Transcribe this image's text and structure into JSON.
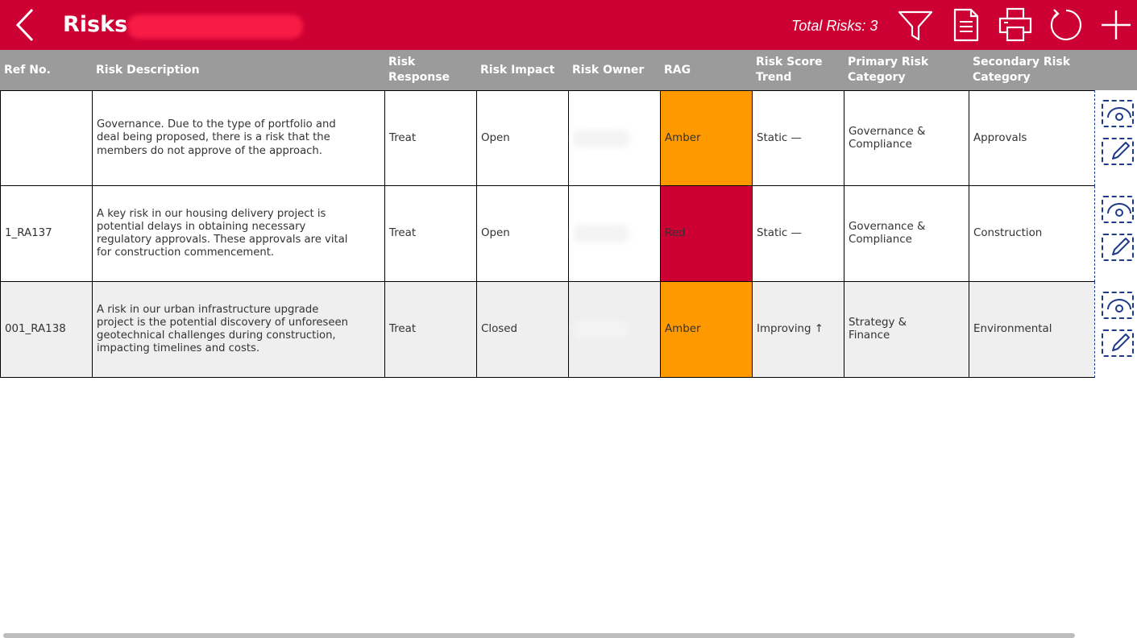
{
  "header": {
    "title": "Risks",
    "total_risks": "Total Risks: 3",
    "colors": {
      "brand": "#cc0033",
      "header_text": "#ffffff"
    },
    "icons": [
      "back-chevron-icon",
      "filter-icon",
      "document-icon",
      "printer-icon",
      "refresh-icon",
      "plus-icon"
    ]
  },
  "table": {
    "columns": [
      "Ref No.",
      "Risk Description",
      "Risk Response",
      "Risk Impact",
      "Risk Owner",
      "RAG",
      "Risk Score Trend",
      "Primary Risk Category",
      "Secondary Risk Category"
    ],
    "rows": [
      {
        "ref": "",
        "description": "Governance. Due to the type of portfolio and deal being proposed, there is a risk that the members do not approve of the approach.",
        "response": "Treat",
        "impact": "Open",
        "owner": "",
        "rag": "Amber",
        "rag_color": "#ff9900",
        "trend": "Static —",
        "primary": "Governance & Compliance",
        "secondary": "Approvals",
        "row_bg": "#ffffff"
      },
      {
        "ref": "1_RA137",
        "description": "A key risk in our housing delivery project is potential delays in obtaining necessary regulatory approvals. These approvals are vital for construction commencement.",
        "response": "Treat",
        "impact": "Open",
        "owner": "",
        "rag": "Red",
        "rag_color": "#cc0033",
        "trend": "Static —",
        "primary": "Governance & Compliance",
        "secondary": "Construction",
        "row_bg": "#ffffff"
      },
      {
        "ref": "001_RA138",
        "description": "A risk in our urban infrastructure upgrade project is the potential discovery of unforeseen geotechnical challenges during construction, impacting timelines and costs.",
        "response": "Treat",
        "impact": "Closed",
        "owner": "",
        "rag": "Amber",
        "rag_color": "#ff9900",
        "trend": "Improving ↑",
        "primary": "Strategy & Finance",
        "secondary": "Environmental",
        "row_bg": "#efefef"
      }
    ],
    "row_actions": [
      "view-icon",
      "edit-icon"
    ],
    "colors": {
      "header_bg": "#9b9b9b",
      "action_accent": "#1f3a8a"
    }
  }
}
